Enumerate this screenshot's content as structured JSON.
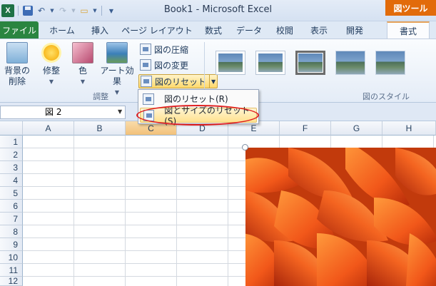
{
  "window": {
    "title": "Book1 - Microsoft Excel",
    "context_tab_header": "図ツール"
  },
  "qat": {
    "app_icon": "excel-icon",
    "icons": [
      "save-icon",
      "undo-icon",
      "redo-icon",
      "open-folder-icon",
      "customize-qat-icon"
    ]
  },
  "tabs": {
    "file": "ファイル",
    "items": [
      "ホーム",
      "挿入",
      "ページ レイアウト",
      "数式",
      "データ",
      "校閲",
      "表示",
      "開発",
      "書式"
    ],
    "active": "書式"
  },
  "ribbon": {
    "adjust": {
      "remove_bg": "背景の\n削除",
      "corrections": "修整",
      "color": "色",
      "artistic": "アート効果",
      "compress": "図の圧縮",
      "change": "図の変更",
      "reset": "図のリセット",
      "group_label": "調整"
    },
    "styles": {
      "group_label": "図のスタイル",
      "thumbnail_count": 5
    }
  },
  "reset_menu": {
    "items": [
      "図のリセット(R)",
      "図とサイズのリセット(S)"
    ],
    "highlighted_index": 1
  },
  "formula_bar": {
    "name_box": "図 2"
  },
  "sheet": {
    "columns": [
      "A",
      "B",
      "C",
      "D",
      "E",
      "F",
      "G",
      "H"
    ],
    "rows": [
      "1",
      "2",
      "3",
      "4",
      "5",
      "6",
      "7",
      "8",
      "9",
      "10",
      "11",
      "12"
    ],
    "selected_column": "C",
    "picture": "orange-flower-petals-photo"
  },
  "colors": {
    "file_tab": "#2a8540",
    "context_tab": "#e26b0a",
    "highlight_ellipse": "#e02020",
    "menu_hover": "#ffe28f"
  }
}
